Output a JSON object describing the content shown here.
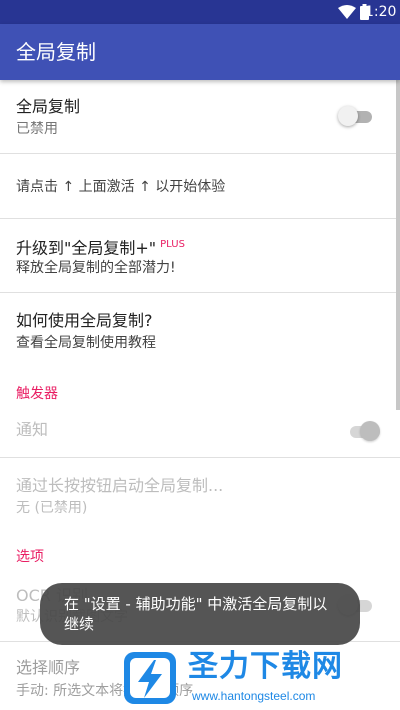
{
  "status_bar": {
    "time": "1:20"
  },
  "app_bar": {
    "title": "全局复制"
  },
  "settings": {
    "enable": {
      "title": "全局复制",
      "subtitle": "已禁用",
      "switch_on": false
    },
    "hint": {
      "text": "请点击 ↑ 上面激活 ↑ 以开始体验"
    },
    "upgrade": {
      "title": "升级到\"全局复制+\"",
      "badge": "PLUS",
      "subtitle": "释放全局复制的全部潜力!"
    },
    "howto": {
      "title": "如何使用全局复制?",
      "subtitle": "查看全局复制使用教程"
    },
    "trigger_header": "触发器",
    "notification": {
      "title": "通知",
      "switch_on": true,
      "enabled": false
    },
    "longpress": {
      "title": "通过长按按钮启动全局复制...",
      "subtitle": "无 (已禁用)"
    },
    "options_header": "选项",
    "ocr": {
      "title": "OCR 识别",
      "subtitle": "默认识别截图文字",
      "switch_on": false
    },
    "order": {
      "title": "选择顺序",
      "subtitle": "手动: 所选文本将按选择顺序"
    }
  },
  "toast": {
    "text": "在 \"设置 - 辅助功能\" 中激活全局复制以继续"
  },
  "watermark": {
    "title": "圣力下载网",
    "url": "www.hantongsteel.com"
  },
  "colors": {
    "status_bar": "#283593",
    "app_bar": "#3f51b5",
    "accent": "#e91e63",
    "watermark": "#1e88e5"
  },
  "icons": {
    "wifi": "wifi-icon",
    "battery": "battery-icon"
  }
}
